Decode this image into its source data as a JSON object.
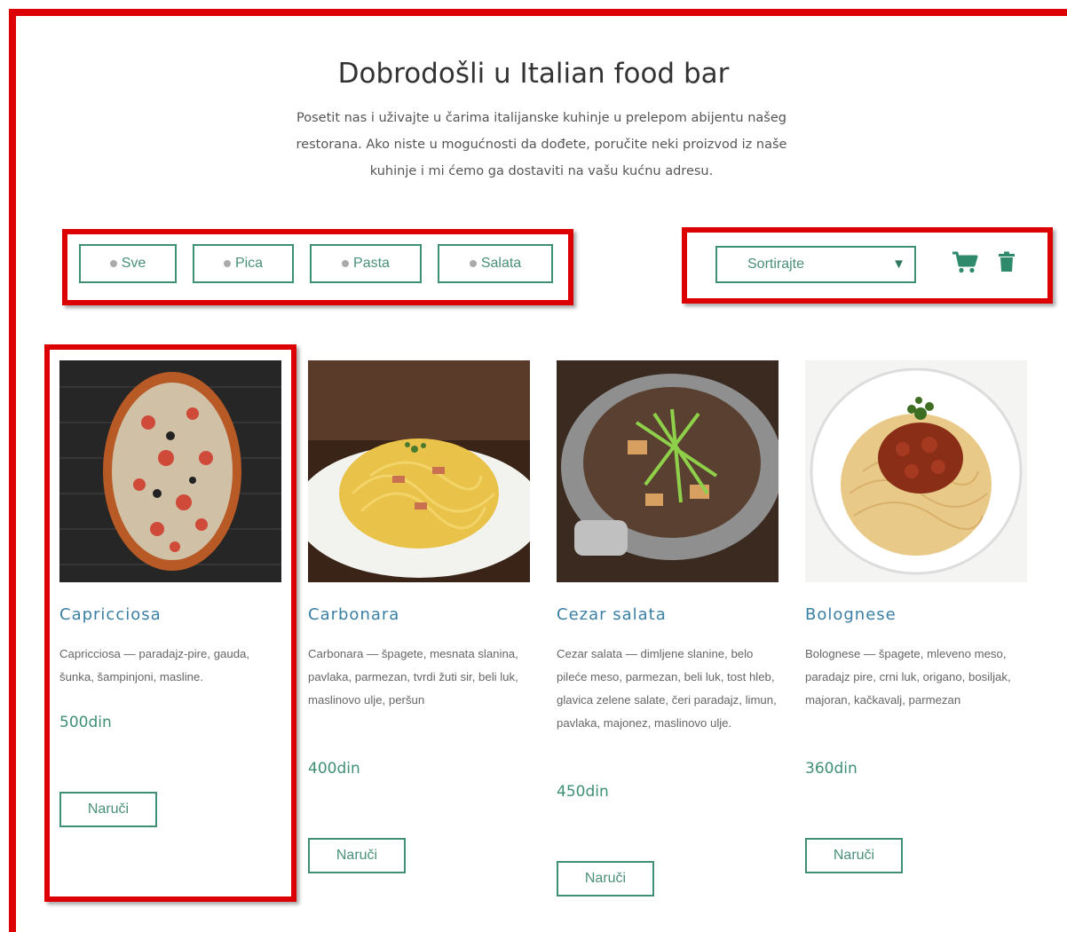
{
  "header": {
    "title": "Dobrodošli u Italian food bar",
    "intro_line1": "Posetit nas i uživajte u čarima italijanske kuhinje u prelepom abijentu našeg",
    "intro_line2": "restorana. Ako niste u mogućnosti da dođete, poručite neki proizvod iz naše",
    "intro_line3": "kuhinje i mi ćemo ga dostaviti na vašu kućnu adresu."
  },
  "filters": [
    {
      "label": "Sve"
    },
    {
      "label": "Pica"
    },
    {
      "label": "Pasta"
    },
    {
      "label": "Salata"
    }
  ],
  "sort": {
    "label": "Sortirajte",
    "arrow": "▼"
  },
  "icons": {
    "cart": "cart-icon",
    "trash": "trash-icon"
  },
  "colors": {
    "accent": "#3f8f75",
    "title_blue": "#3a7fa4",
    "highlight_red": "#dd0000"
  },
  "products": [
    {
      "name": "Capricciosa",
      "description": "Capricciosa — paradajz-pire, gauda, šunka, šampinjoni, masline.",
      "price": "500din",
      "order_label": "Naruči"
    },
    {
      "name": "Carbonara",
      "description": "Carbonara — špagete, mesnata slanina, pavlaka, parmezan, tvrdi žuti sir, beli luk, maslinovo ulje, peršun",
      "price": "400din",
      "order_label": "Naruči"
    },
    {
      "name": "Cezar salata",
      "description": "Cezar salata — dimljene slanine, belo pileće meso, parmezan, beli luk, tost hleb, glavica zelene salate, čeri paradajz, limun, pavlaka, majonez, maslinovo ulje.",
      "price": "450din",
      "order_label": "Naruči"
    },
    {
      "name": "Bolognese",
      "description": "Bolognese — špagete, mleveno meso, paradajz pire, crni luk, origano, bosiljak, majoran, kačkavalj, parmezan",
      "price": "360din",
      "order_label": "Naruči"
    }
  ]
}
